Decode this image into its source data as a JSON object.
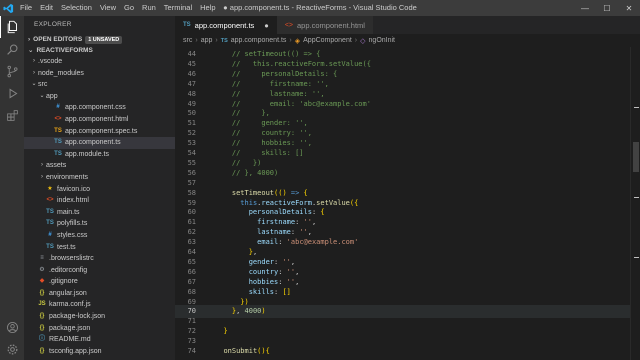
{
  "window": {
    "title": "● app.component.ts - ReactiveForms - Visual Studio Code",
    "menu": [
      "File",
      "Edit",
      "Selection",
      "View",
      "Go",
      "Run",
      "Terminal",
      "Help"
    ]
  },
  "sidebar": {
    "header": "EXPLORER",
    "open_editors": "OPEN EDITORS",
    "unsaved_badge": "1 UNSAVED",
    "project": "REACTIVEFORMS",
    "tree": [
      {
        "label": ".vscode",
        "kind": "folder",
        "depth": 1,
        "chev": "›"
      },
      {
        "label": "node_modules",
        "kind": "folder",
        "depth": 1,
        "chev": "›"
      },
      {
        "label": "src",
        "kind": "folder",
        "depth": 1,
        "chev": "⌄"
      },
      {
        "label": "app",
        "kind": "folder",
        "depth": 2,
        "chev": "⌄"
      },
      {
        "label": "app.component.css",
        "kind": "css",
        "depth": 3
      },
      {
        "label": "app.component.html",
        "kind": "html",
        "depth": 3
      },
      {
        "label": "app.component.spec.ts",
        "kind": "spec",
        "depth": 3
      },
      {
        "label": "app.component.ts",
        "kind": "ts",
        "depth": 3,
        "selected": true
      },
      {
        "label": "app.module.ts",
        "kind": "ts",
        "depth": 3
      },
      {
        "label": "assets",
        "kind": "folder",
        "depth": 2,
        "chev": "›"
      },
      {
        "label": "environments",
        "kind": "folder",
        "depth": 2,
        "chev": "›"
      },
      {
        "label": "favicon.ico",
        "kind": "ico",
        "depth": 2
      },
      {
        "label": "index.html",
        "kind": "html",
        "depth": 2
      },
      {
        "label": "main.ts",
        "kind": "ts",
        "depth": 2
      },
      {
        "label": "polyfills.ts",
        "kind": "ts",
        "depth": 2
      },
      {
        "label": "styles.css",
        "kind": "css",
        "depth": 2
      },
      {
        "label": "test.ts",
        "kind": "ts",
        "depth": 2
      },
      {
        "label": ".browserslistrc",
        "kind": "cfg",
        "depth": 1
      },
      {
        "label": ".editorconfig",
        "kind": "gear",
        "depth": 1
      },
      {
        "label": ".gitignore",
        "kind": "git",
        "depth": 1
      },
      {
        "label": "angular.json",
        "kind": "json",
        "depth": 1
      },
      {
        "label": "karma.conf.js",
        "kind": "js",
        "depth": 1
      },
      {
        "label": "package-lock.json",
        "kind": "json",
        "depth": 1
      },
      {
        "label": "package.json",
        "kind": "json",
        "depth": 1
      },
      {
        "label": "README.md",
        "kind": "md",
        "depth": 1
      },
      {
        "label": "tsconfig.app.json",
        "kind": "json",
        "depth": 1
      }
    ]
  },
  "tabs": [
    {
      "label": "app.component.ts",
      "type": "TS",
      "active": true
    },
    {
      "label": "app.component.html",
      "type": "html",
      "active": false
    }
  ],
  "breadcrumb": [
    "src",
    "app",
    "app.component.ts",
    "AppComponent",
    "ngOnInit"
  ],
  "breadcrumb_ts": "TS",
  "editor": {
    "current_line": 70,
    "lines": [
      {
        "n": 44,
        "t": "    // setTimeout(() => {"
      },
      {
        "n": 45,
        "t": "    //   this.reactiveForm.setValue({"
      },
      {
        "n": 46,
        "t": "    //     personalDetails: {"
      },
      {
        "n": 47,
        "t": "    //       firstname: '',"
      },
      {
        "n": 48,
        "t": "    //       lastname: '',"
      },
      {
        "n": 49,
        "t": "    //       email: 'abc@example.com'"
      },
      {
        "n": 50,
        "t": "    //     },"
      },
      {
        "n": 51,
        "t": "    //     gender: '',"
      },
      {
        "n": 52,
        "t": "    //     country: '',"
      },
      {
        "n": 53,
        "t": "    //     hobbies: '',"
      },
      {
        "n": 54,
        "t": "    //     skills: []"
      },
      {
        "n": 55,
        "t": "    //   })"
      },
      {
        "n": 56,
        "t": "    // }, 4000)"
      },
      {
        "n": 57,
        "t": ""
      },
      {
        "n": 58,
        "t": "    setTimeout(() => {"
      },
      {
        "n": 59,
        "t": "      this.reactiveForm.setValue({"
      },
      {
        "n": 60,
        "t": "        personalDetails: {"
      },
      {
        "n": 61,
        "t": "          firstname: '',"
      },
      {
        "n": 62,
        "t": "          lastname: '',"
      },
      {
        "n": 63,
        "t": "          email: 'abc@example.com'"
      },
      {
        "n": 64,
        "t": "        },"
      },
      {
        "n": 65,
        "t": "        gender: '',"
      },
      {
        "n": 66,
        "t": "        country: '',"
      },
      {
        "n": 67,
        "t": "        hobbies: '',"
      },
      {
        "n": 68,
        "t": "        skills: []"
      },
      {
        "n": 69,
        "t": "      })"
      },
      {
        "n": 70,
        "t": "    }, 4000)"
      },
      {
        "n": 71,
        "t": ""
      },
      {
        "n": 72,
        "t": "  }"
      },
      {
        "n": 73,
        "t": ""
      },
      {
        "n": 74,
        "t": "  onSubmit(){"
      }
    ]
  },
  "colors": {
    "accent": "#007acc",
    "comment": "#6a9955",
    "string": "#ce9178",
    "number": "#b5cea8",
    "function": "#dcdcaa",
    "keyword": "#569cd6",
    "property": "#9cdcfe"
  }
}
